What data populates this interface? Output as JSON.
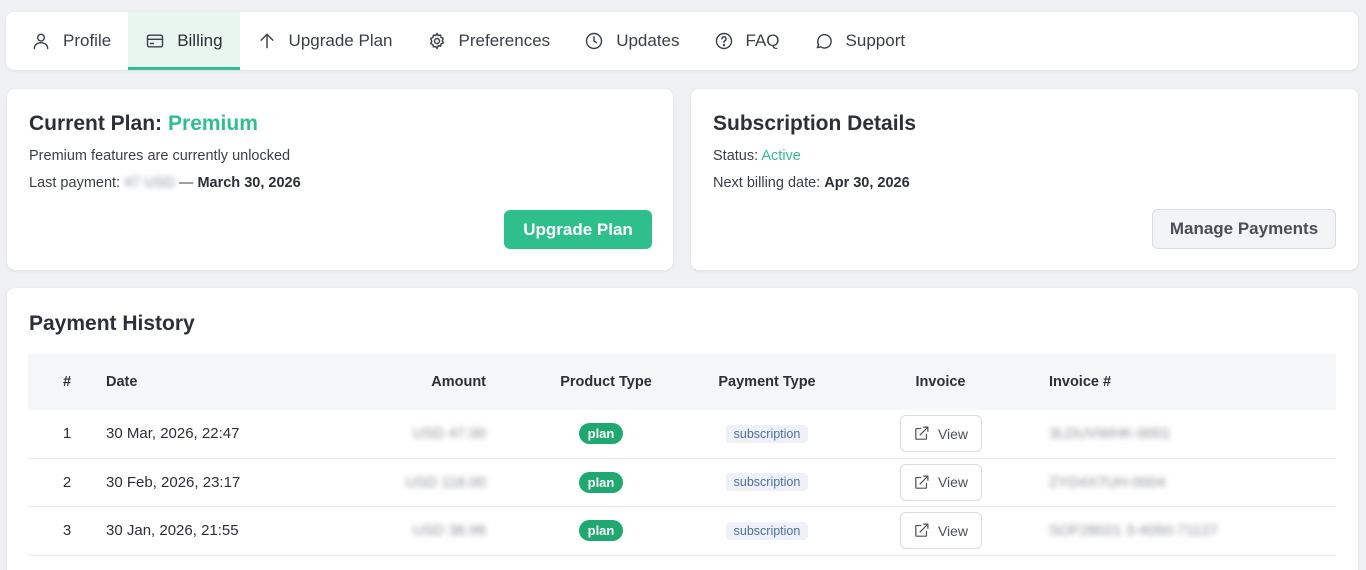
{
  "tabs": [
    {
      "label": "Profile",
      "icon": "user-icon"
    },
    {
      "label": "Billing",
      "icon": "credit-card-icon",
      "active": true
    },
    {
      "label": "Upgrade Plan",
      "icon": "arrow-up-icon"
    },
    {
      "label": "Preferences",
      "icon": "gear-icon"
    },
    {
      "label": "Updates",
      "icon": "clock-icon"
    },
    {
      "label": "FAQ",
      "icon": "question-icon"
    },
    {
      "label": "Support",
      "icon": "chat-icon"
    }
  ],
  "plan": {
    "title": "Current Plan:",
    "name": "Premium",
    "description": "Premium features are currently unlocked",
    "last_payment_label": "Last payment:",
    "last_payment_amount": "47 USD",
    "last_payment_sep": "—",
    "last_payment_date": "March 30, 2026",
    "upgrade_button": "Upgrade Plan"
  },
  "subscription": {
    "title": "Subscription Details",
    "status_label": "Status:",
    "status_value": "Active",
    "next_billing_label": "Next billing date:",
    "next_billing_value": "Apr 30, 2026",
    "manage_button": "Manage Payments"
  },
  "history": {
    "title": "Payment History",
    "columns": {
      "num": "#",
      "date": "Date",
      "amount": "Amount",
      "product": "Product Type",
      "payment": "Payment Type",
      "invoice": "Invoice",
      "invoice_no": "Invoice #"
    },
    "view_label": "View",
    "rows": [
      {
        "num": "1",
        "date": "30 Mar, 2026, 22:47",
        "amount": "USD 47.00",
        "product": "plan",
        "payment": "subscription",
        "invoice_no": "3LDUVWHK-0001"
      },
      {
        "num": "2",
        "date": "30 Feb, 2026, 23:17",
        "amount": "USD 118.00",
        "product": "plan",
        "payment": "subscription",
        "invoice_no": "ZYD4X7UH-0004"
      },
      {
        "num": "3",
        "date": "30 Jan, 2026, 21:55",
        "amount": "USD 38.96",
        "product": "plan",
        "payment": "subscription",
        "invoice_no": "SOF28021 3-4050-71127"
      }
    ]
  },
  "colors": {
    "accent": "#2fbf8c",
    "badge_plan": "#1fa86f"
  }
}
